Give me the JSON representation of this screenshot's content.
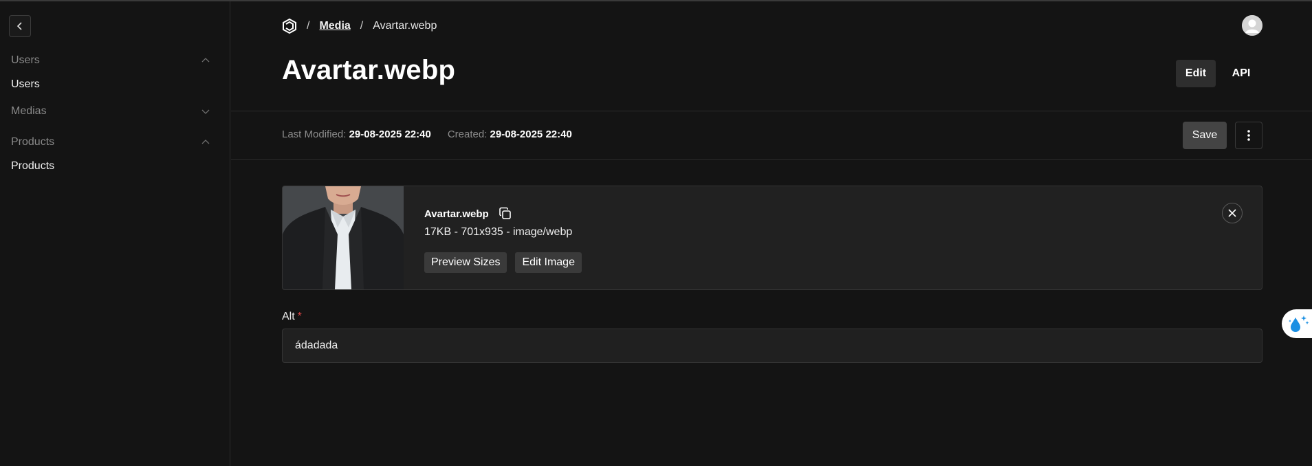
{
  "sidebar": {
    "groups": [
      {
        "label": "Users",
        "expanded": true,
        "items": [
          {
            "label": "Users"
          }
        ]
      },
      {
        "label": "Medias",
        "expanded": false,
        "items": []
      },
      {
        "label": "Products",
        "expanded": true,
        "items": [
          {
            "label": "Products"
          }
        ]
      }
    ]
  },
  "breadcrumb": {
    "separator": "/",
    "link": "Media",
    "current": "Avartar.webp"
  },
  "header": {
    "title": "Avartar.webp",
    "tabs": [
      {
        "label": "Edit",
        "active": true
      },
      {
        "label": "API",
        "active": false
      }
    ]
  },
  "meta": {
    "modified_label": "Last Modified:",
    "modified_value": "29-08-2025 22:40",
    "created_label": "Created:",
    "created_value": "29-08-2025 22:40"
  },
  "actions": {
    "save_label": "Save"
  },
  "file": {
    "name": "Avartar.webp",
    "info": "17KB - 701x935 - image/webp",
    "preview_sizes_label": "Preview Sizes",
    "edit_image_label": "Edit Image"
  },
  "alt_field": {
    "label": "Alt",
    "required_mark": "*",
    "value": "ádadada"
  },
  "colors": {
    "background": "#141414",
    "panel": "#212121",
    "border": "#353535",
    "required": "#e04646",
    "widget_accent": "#1a8fe3"
  },
  "icons": [
    "chevron-left-icon",
    "chevron-up-icon",
    "chevron-down-icon",
    "logo-icon",
    "user-avatar-icon",
    "more-vertical-icon",
    "copy-icon",
    "close-icon",
    "water-drop-sparkle-icon"
  ]
}
